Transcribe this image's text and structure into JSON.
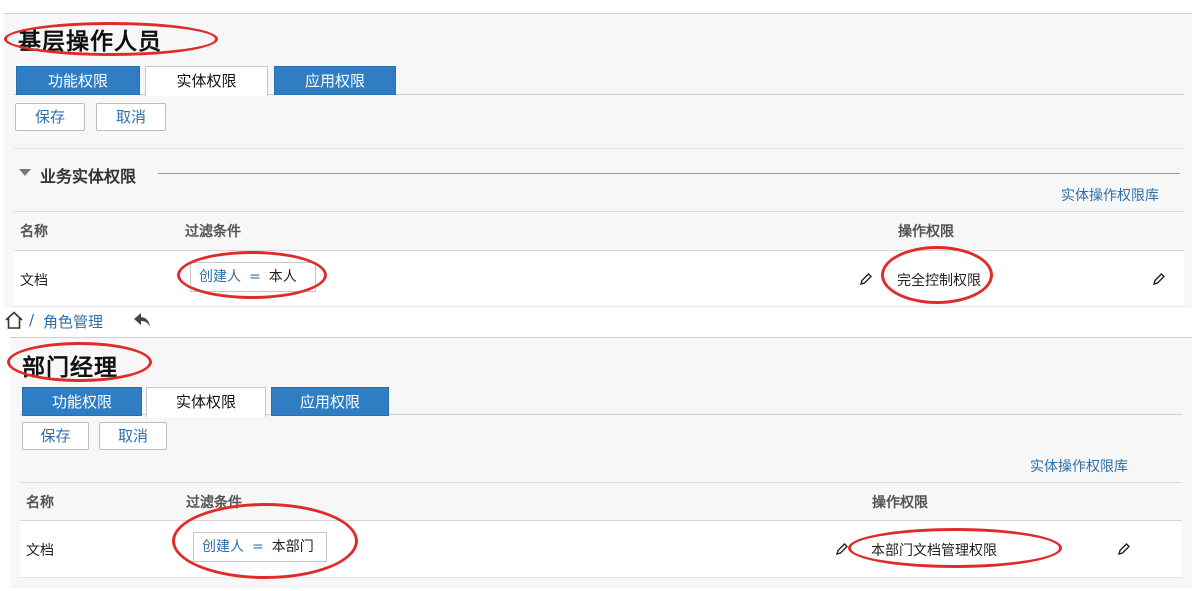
{
  "panel1": {
    "title": "基层操作人员",
    "tabs": [
      {
        "label": "功能权限",
        "active": false
      },
      {
        "label": "实体权限",
        "active": true
      },
      {
        "label": "应用权限",
        "active": false
      }
    ],
    "save_label": "保存",
    "cancel_label": "取消",
    "section_title": "业务实体权限",
    "library_link": "实体操作权限库",
    "columns": {
      "name": "名称",
      "filter": "过滤条件",
      "permission": "操作权限"
    },
    "row": {
      "name": "文档",
      "filter_field": "创建人",
      "filter_op": "=",
      "filter_value": "本人",
      "permission": "完全控制权限"
    }
  },
  "breadcrumb": {
    "separator": "/",
    "label": "角色管理"
  },
  "panel2": {
    "title": "部门经理",
    "tabs": [
      {
        "label": "功能权限",
        "active": false
      },
      {
        "label": "实体权限",
        "active": true
      },
      {
        "label": "应用权限",
        "active": false
      }
    ],
    "save_label": "保存",
    "cancel_label": "取消",
    "library_link": "实体操作权限库",
    "columns": {
      "name": "名称",
      "filter": "过滤条件",
      "permission": "操作权限"
    },
    "row": {
      "name": "文档",
      "filter_field": "创建人",
      "filter_op": "=",
      "filter_value": "本部门",
      "permission": "本部门文档管理权限"
    }
  },
  "colors": {
    "accent": "#2f7ec3",
    "link": "#2f6fa8",
    "annotation": "#e02b2b"
  }
}
